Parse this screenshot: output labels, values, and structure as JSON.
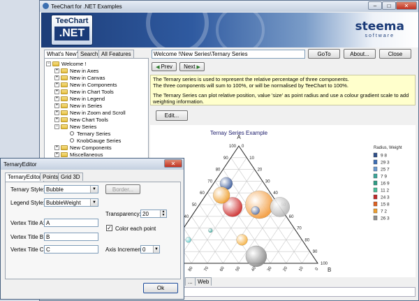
{
  "main_window": {
    "title": "TeeChart for .NET Examples",
    "logo_line1": "TeeChart",
    "logo_line2": ".NET",
    "brand": "steema",
    "brand_sub": "software",
    "controls": {
      "minimize": "–",
      "maximize": "□",
      "close": "✕"
    }
  },
  "left_tabs": [
    "What's New?",
    "Search",
    "All Features"
  ],
  "tree": [
    {
      "label": "Welcome !",
      "type": "root"
    },
    {
      "label": "New in Axes",
      "type": "folder"
    },
    {
      "label": "New in Canvas",
      "type": "folder"
    },
    {
      "label": "New in Components",
      "type": "folder"
    },
    {
      "label": "New in Chart Tools",
      "type": "folder"
    },
    {
      "label": "New in Legend",
      "type": "folder"
    },
    {
      "label": "New in Series",
      "type": "folder"
    },
    {
      "label": "New in Zoom and Scroll",
      "type": "folder"
    },
    {
      "label": "New Chart Tools",
      "type": "folder"
    },
    {
      "label": "New Series",
      "type": "folder-open"
    },
    {
      "label": "Ternary Series",
      "type": "leaf"
    },
    {
      "label": "KnobGauge Series",
      "type": "leaf"
    },
    {
      "label": "New Components",
      "type": "folder"
    },
    {
      "label": "Miscellaneous",
      "type": "folder"
    }
  ],
  "top_bar": {
    "path": "Welcome !\\New Series\\Ternary Series",
    "goto": "GoTo",
    "about": "About...",
    "close": "Close"
  },
  "nav": {
    "prev": "Prev",
    "next": "Next"
  },
  "description": [
    "The Ternary series is used to represent the relative percentage of three components.",
    "The three components will sum to 100%, or will be normalised by TeeChart to 100%.",
    "",
    "The Ternary Series can plot relative position, value 'size' as point radius and use a colour gradient scale to add weighting information."
  ],
  "edit_button": "Edit...",
  "bottom_tabs": [
    "...",
    "Web"
  ],
  "chart_data": {
    "type": "scatter",
    "title": "Ternay Series Example",
    "vertex_a": "A",
    "vertex_b": "B",
    "vertex_c": "C",
    "ticks": [
      "0",
      "10",
      "20",
      "30",
      "40",
      "50",
      "60",
      "70",
      "80",
      "90",
      "100"
    ],
    "legend_title": "Radius, Weight",
    "legend": [
      {
        "label": "9 8",
        "color": "#2e4f8a"
      },
      {
        "label": "29 3",
        "color": "#3e6eb5"
      },
      {
        "label": "25 7",
        "color": "#6a9ad0"
      },
      {
        "label": "7 9",
        "color": "#3aa69a"
      },
      {
        "label": "16 9",
        "color": "#2e9c84"
      },
      {
        "label": "11 2",
        "color": "#4abf9a"
      },
      {
        "label": "24 3",
        "color": "#c02828"
      },
      {
        "label": "15 8",
        "color": "#e06020"
      },
      {
        "label": "7 2",
        "color": "#f0a030"
      },
      {
        "label": "26 3",
        "color": "#909090"
      }
    ],
    "points": [
      {
        "a": 68,
        "b": 8,
        "c": 24,
        "r": 9,
        "color": "#3a5a9a"
      },
      {
        "a": 48,
        "b": 22,
        "c": 30,
        "r": 14,
        "color": "#cc2a2a"
      },
      {
        "a": 58,
        "b": 10,
        "c": 32,
        "r": 12,
        "color": "#f0a030"
      },
      {
        "a": 50,
        "b": 38,
        "c": 12,
        "r": 20,
        "color": "#f39a3a"
      },
      {
        "a": 48,
        "b": 52,
        "c": 0,
        "r": 14,
        "color": "#b8b8b8"
      },
      {
        "a": 45,
        "b": 38,
        "c": 17,
        "r": 6,
        "color": "#5a7ab5"
      },
      {
        "a": 20,
        "b": 42,
        "c": 38,
        "r": 8,
        "color": "#f5b040"
      },
      {
        "a": 6,
        "b": 58,
        "c": 36,
        "r": 15,
        "color": "#8a8a8a"
      },
      {
        "a": 28,
        "b": 18,
        "c": 54,
        "r": 3,
        "color": "#3aa69a"
      },
      {
        "a": 20,
        "b": 8,
        "c": 72,
        "r": 4,
        "color": "#66cccc"
      },
      {
        "a": 6,
        "b": 2,
        "c": 92,
        "r": 7,
        "color": "#3aa69a"
      }
    ]
  },
  "dialog": {
    "title": "TernaryEditor",
    "tabs": [
      "TernaryEditor",
      "Points",
      "Grid 3D"
    ],
    "ternary_style_label": "Ternary Style:",
    "ternary_style_value": "Bubble",
    "legend_style_label": "Legend Style:",
    "legend_style_value": "BubbleWeight",
    "border_button": "Border...",
    "transparency_label": "Transparency:",
    "transparency_value": "20",
    "vertex_a_label": "Vertex Title A:",
    "vertex_a_value": "A",
    "vertex_b_label": "Vertex Title B:",
    "vertex_b_value": "B",
    "vertex_c_label": "Vertex Title C:",
    "vertex_c_value": "C",
    "color_each_label": "Color each point",
    "axis_increment_label": "Axis Increment",
    "axis_increment_value": "0",
    "ok": "Ok",
    "close": "✕"
  }
}
